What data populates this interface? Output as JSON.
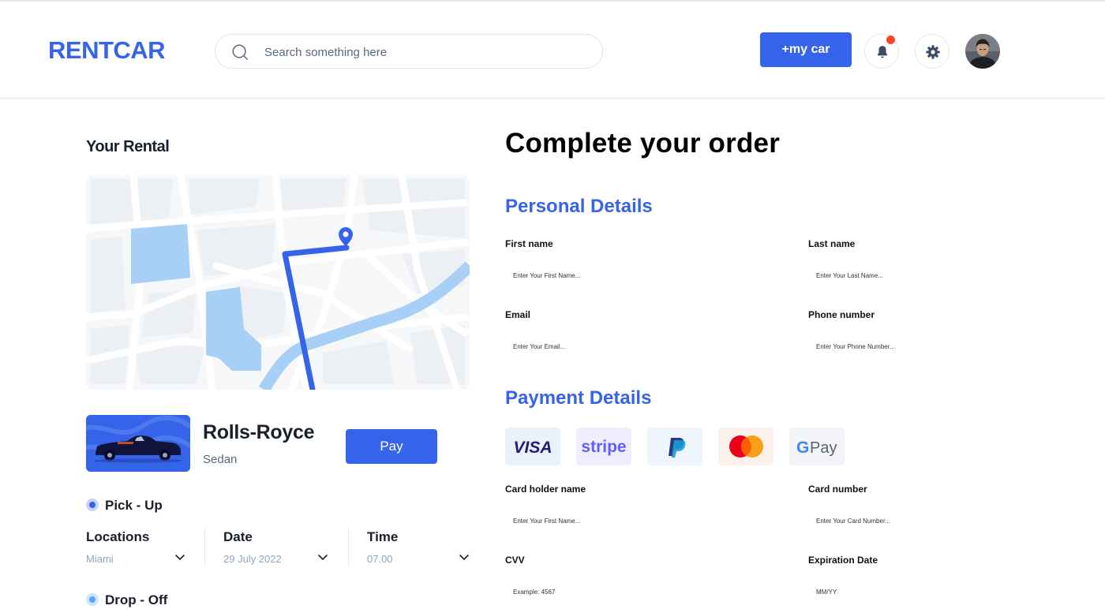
{
  "header": {
    "logo": "RENTCAR",
    "search_placeholder": "Search something here",
    "add_car_label": "+my car"
  },
  "rental": {
    "section_title": "Your Rental",
    "car_name": "Rolls-Royce",
    "car_type": "Sedan",
    "pay_label": "Pay",
    "pickup": {
      "label": "Pick - Up",
      "location_label": "Locations",
      "location_value": "Miami",
      "date_label": "Date",
      "date_value": "29 July 2022",
      "time_label": "Time",
      "time_value": "07.00"
    },
    "dropoff": {
      "label": "Drop - Off"
    }
  },
  "order": {
    "title": "Complete your order",
    "personal": {
      "title": "Personal Details",
      "first_name_label": "First name",
      "first_name_placeholder": "Enter Your First Name...",
      "last_name_label": "Last name",
      "last_name_placeholder": "Enter Your Last Name...",
      "email_label": "Email",
      "email_placeholder": "Enter Your Email...",
      "phone_label": "Phone number",
      "phone_placeholder": "Enter Your Phone Number..."
    },
    "payment": {
      "title": "Payment Details",
      "methods": [
        "VISA",
        "stripe",
        "PayPal",
        "Mastercard",
        "G Pay"
      ],
      "holder_label": "Card holder name",
      "holder_placeholder": "Enter Your First Name...",
      "card_number_label": "Card number",
      "card_number_placeholder": "Enter Your Card Number...",
      "cvv_label": "CVV",
      "cvv_placeholder": "Example: 4567",
      "expiry_label": "Expiration Date",
      "expiry_placeholder": "MM/YY"
    }
  },
  "colors": {
    "primary": "#3563e9",
    "notification": "#ff4423",
    "map_water": "#a8cff5",
    "map_bg": "#f6f7f9",
    "muted_text": "#90a3bf"
  }
}
